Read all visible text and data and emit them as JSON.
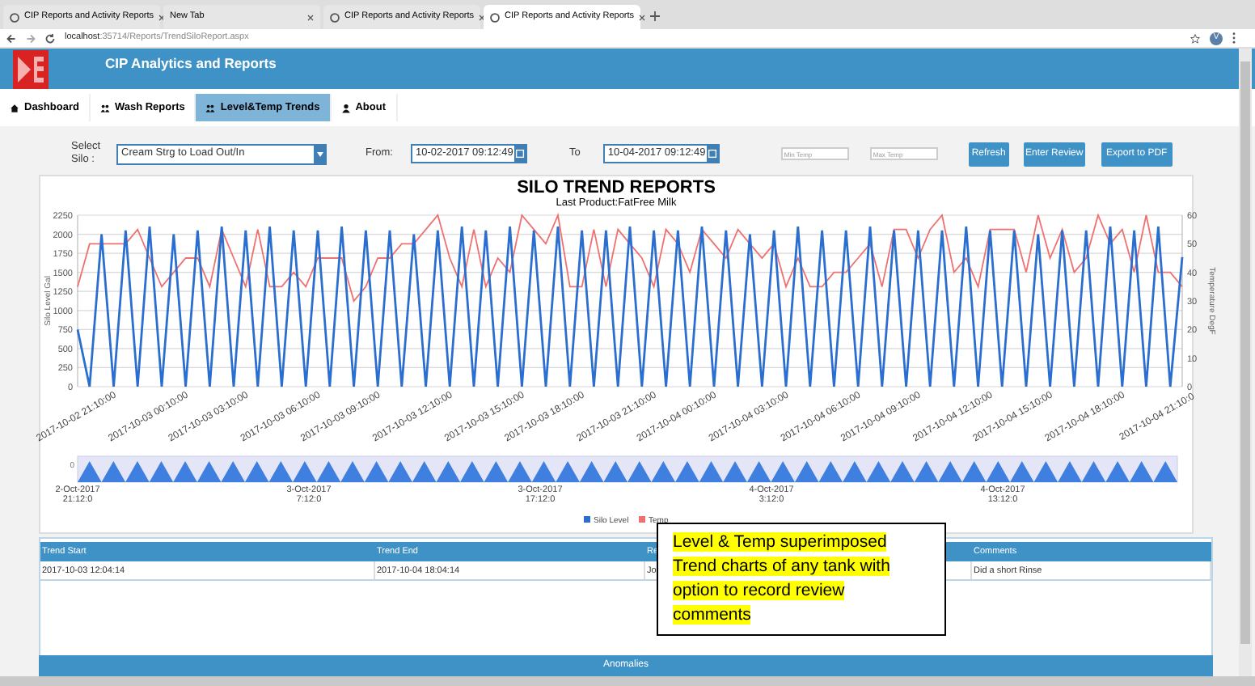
{
  "browser": {
    "tabs": [
      {
        "title": "CIP Reports and Activity Reports",
        "selected": false
      },
      {
        "title": "New Tab",
        "selected": false
      },
      {
        "title": "CIP Reports and Activity Reports",
        "selected": false
      },
      {
        "title": "CIP Reports and Activity Reports",
        "selected": true
      }
    ],
    "url_host": "localhost",
    "url_path": ":35714/Reports/TrendSiloReport.aspx",
    "avatar": "V"
  },
  "app": {
    "title": "CIP Analytics and Reports"
  },
  "nav": [
    {
      "label": "Dashboard",
      "kind": "home",
      "selected": false
    },
    {
      "label": "Wash Reports",
      "kind": "group",
      "selected": false
    },
    {
      "label": "Level&Temp Trends",
      "kind": "group",
      "selected": true
    },
    {
      "label": "About",
      "kind": "user",
      "selected": false
    }
  ],
  "filters": {
    "silo_label": "Select Silo :",
    "silo_value": "Cream Strg to Load Out/In",
    "from_label": "From:",
    "from_value": "10-02-2017 09:12:49",
    "to_label": "To",
    "to_value": "10-04-2017 09:12:49",
    "min_placeholder": "Min Temp",
    "max_placeholder": "Max Temp"
  },
  "buttons": [
    "Refresh",
    "Enter Review",
    "Export to PDF"
  ],
  "report": {
    "title": "SILO TREND REPORTS",
    "subtitle": "Last Product:FatFree Milk",
    "chart_data": {
      "type": "line",
      "grid": true,
      "legend": "bottom",
      "ylabel": "Silo Level Gal",
      "y2label": "Temperature DegF",
      "ylim": [
        0,
        2250
      ],
      "y2lim": [
        0,
        60
      ],
      "yticks": [
        0,
        250,
        500,
        750,
        1000,
        1250,
        1500,
        1750,
        2000,
        2250
      ],
      "y2ticks": [
        0,
        10,
        20,
        30,
        40,
        50,
        60
      ],
      "categories": [
        "2017-10-02 21:10:00",
        null,
        null,
        null,
        null,
        null,
        "2017-10-03 00:10:00",
        null,
        null,
        null,
        null,
        "2017-10-03 03:10:00",
        null,
        null,
        null,
        null,
        null,
        "2017-10-03 06:10:00",
        null,
        null,
        null,
        null,
        "2017-10-03 09:10:00",
        null,
        null,
        null,
        null,
        null,
        "2017-10-03 12:10:00",
        null,
        null,
        null,
        null,
        null,
        "2017-10-03 15:10:00",
        null,
        null,
        null,
        null,
        "2017-10-03 18:10:00",
        null,
        null,
        null,
        null,
        null,
        "2017-10-03 21:10:00",
        null,
        null,
        null,
        null,
        "2017-10-04 00:10:00",
        null,
        null,
        null,
        null,
        null,
        "2017-10-04 03:10:00",
        null,
        null,
        null,
        null,
        null,
        "2017-10-04 06:10:00",
        null,
        null,
        null,
        null,
        "2017-10-04 09:10:00",
        null,
        null,
        null,
        null,
        null,
        "2017-10-04 12:10:00",
        null,
        null,
        null,
        null,
        "2017-10-04 15:10:00",
        null,
        null,
        null,
        null,
        null,
        "2017-10-04 18:10:00",
        null,
        null,
        null,
        null,
        null,
        "2017-10-04 21:10:0",
        null,
        null
      ],
      "series": [
        {
          "name": "Silo Level",
          "color": "#2a6fd0",
          "values": [
            750,
            0,
            2000,
            0,
            2050,
            0,
            2100,
            0,
            2000,
            0,
            2050,
            0,
            2100,
            0,
            2050,
            0,
            2100,
            0,
            2050,
            0,
            2050,
            0,
            2100,
            0,
            2050,
            0,
            2050,
            0,
            2000,
            0,
            2050,
            0,
            2100,
            0,
            2050,
            0,
            2100,
            0,
            2050,
            0,
            2100,
            0,
            2050,
            0,
            2050,
            0,
            2100,
            0,
            2050,
            0,
            2050,
            0,
            2100,
            0,
            2050,
            0,
            2000,
            0,
            2050,
            0,
            2100,
            0,
            2050,
            0,
            2050,
            0,
            2100,
            0,
            2050,
            0,
            2050,
            0,
            2050,
            0,
            2100,
            0,
            2050,
            0,
            2050,
            0,
            2000,
            0,
            2050,
            0,
            2050,
            0,
            2100,
            0,
            2050,
            0,
            2100,
            0,
            1700
          ]
        },
        {
          "name": "Temp",
          "color": "#f07070",
          "axis": "y2",
          "values": [
            35,
            50,
            50,
            50,
            50,
            55,
            45,
            35,
            40,
            45,
            45,
            35,
            55,
            45,
            35,
            55,
            35,
            35,
            40,
            35,
            45,
            45,
            45,
            30,
            35,
            45,
            45,
            50,
            50,
            55,
            60,
            45,
            35,
            55,
            35,
            45,
            40,
            60,
            55,
            50,
            60,
            35,
            35,
            55,
            35,
            55,
            50,
            45,
            35,
            55,
            50,
            40,
            55,
            50,
            45,
            55,
            50,
            45,
            50,
            35,
            45,
            35,
            35,
            40,
            40,
            45,
            50,
            35,
            55,
            55,
            45,
            55,
            60,
            40,
            45,
            35,
            55,
            55,
            55,
            40,
            60,
            45,
            55,
            40,
            45,
            60,
            50,
            55,
            40,
            60,
            40,
            40,
            35
          ]
        }
      ]
    },
    "navigator": {
      "axis_label": "0",
      "labels": [
        [
          "2-Oct-2017",
          "21:12:0"
        ],
        [
          "3-Oct-2017",
          "7:12:0"
        ],
        [
          "3-Oct-2017",
          "17:12:0"
        ],
        [
          "4-Oct-2017",
          "3:12:0"
        ],
        [
          "4-Oct-2017",
          "13:12:0"
        ]
      ]
    }
  },
  "table": {
    "columns": [
      "Trend Start",
      "Trend End",
      "Re",
      "Comments"
    ],
    "rows": [
      [
        "2017-10-03 12:04:14",
        "2017-10-04 18:04:14",
        "Jo",
        "Did a short Rinse"
      ]
    ]
  },
  "anomalies": "Anomalies",
  "annotation": "Level & Temp superimposed Trend charts of any tank with option to record review comments"
}
